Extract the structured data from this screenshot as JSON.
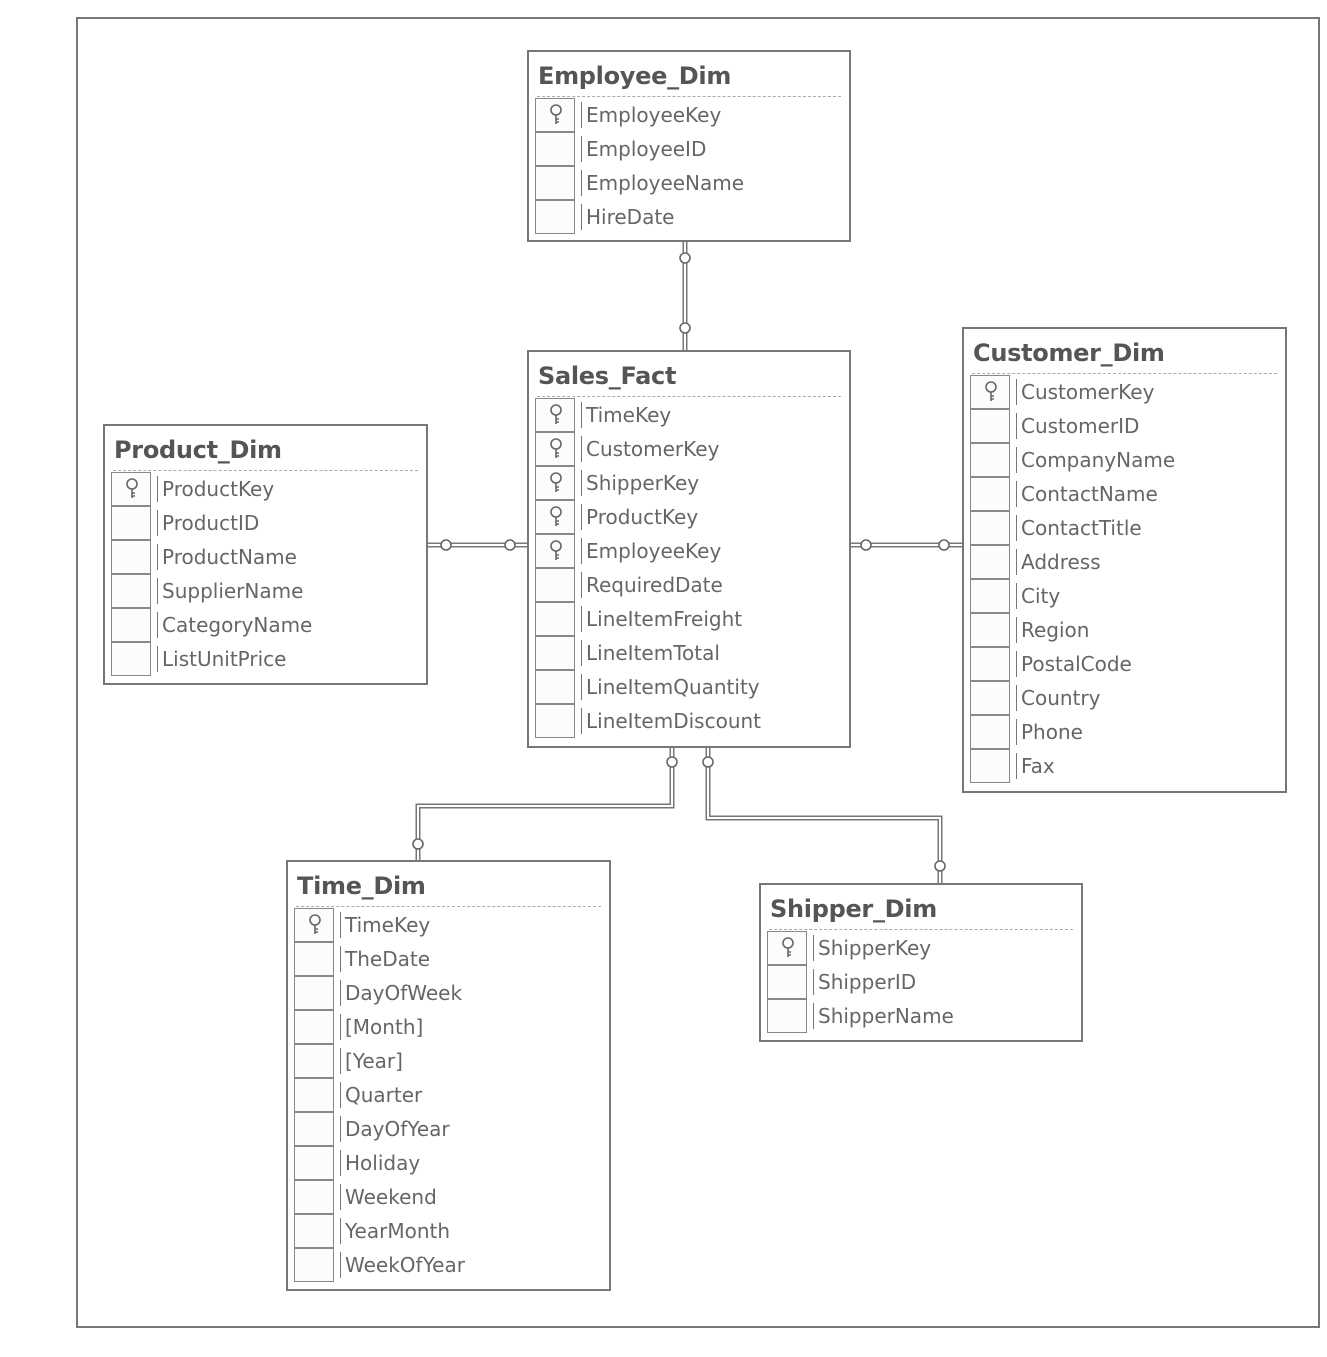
{
  "tables": [
    {
      "id": "employee",
      "name": "Employee_Dim",
      "fields": [
        {
          "name": "EmployeeKey",
          "key": true
        },
        {
          "name": "EmployeeID",
          "key": false
        },
        {
          "name": "EmployeeName",
          "key": false
        },
        {
          "name": "HireDate",
          "key": false
        }
      ]
    },
    {
      "id": "sales",
      "name": "Sales_Fact",
      "fields": [
        {
          "name": "TimeKey",
          "key": true
        },
        {
          "name": "CustomerKey",
          "key": true
        },
        {
          "name": "ShipperKey",
          "key": true
        },
        {
          "name": "ProductKey",
          "key": true
        },
        {
          "name": "EmployeeKey",
          "key": true
        },
        {
          "name": "RequiredDate",
          "key": false
        },
        {
          "name": "LineItemFreight",
          "key": false
        },
        {
          "name": "LineItemTotal",
          "key": false
        },
        {
          "name": "LineItemQuantity",
          "key": false
        },
        {
          "name": "LineItemDiscount",
          "key": false
        }
      ]
    },
    {
      "id": "product",
      "name": "Product_Dim",
      "fields": [
        {
          "name": "ProductKey",
          "key": true
        },
        {
          "name": "ProductID",
          "key": false
        },
        {
          "name": "ProductName",
          "key": false
        },
        {
          "name": "SupplierName",
          "key": false
        },
        {
          "name": "CategoryName",
          "key": false
        },
        {
          "name": "ListUnitPrice",
          "key": false
        }
      ]
    },
    {
      "id": "customer",
      "name": "Customer_Dim",
      "fields": [
        {
          "name": "CustomerKey",
          "key": true
        },
        {
          "name": "CustomerID",
          "key": false
        },
        {
          "name": "CompanyName",
          "key": false
        },
        {
          "name": "ContactName",
          "key": false
        },
        {
          "name": "ContactTitle",
          "key": false
        },
        {
          "name": "Address",
          "key": false
        },
        {
          "name": "City",
          "key": false
        },
        {
          "name": "Region",
          "key": false
        },
        {
          "name": "PostalCode",
          "key": false
        },
        {
          "name": "Country",
          "key": false
        },
        {
          "name": "Phone",
          "key": false
        },
        {
          "name": "Fax",
          "key": false
        }
      ]
    },
    {
      "id": "time",
      "name": "Time_Dim",
      "fields": [
        {
          "name": "TimeKey",
          "key": true
        },
        {
          "name": "TheDate",
          "key": false
        },
        {
          "name": "DayOfWeek",
          "key": false
        },
        {
          "name": "[Month]",
          "key": false
        },
        {
          "name": "[Year]",
          "key": false
        },
        {
          "name": "Quarter",
          "key": false
        },
        {
          "name": "DayOfYear",
          "key": false
        },
        {
          "name": "Holiday",
          "key": false
        },
        {
          "name": "Weekend",
          "key": false
        },
        {
          "name": "YearMonth",
          "key": false
        },
        {
          "name": "WeekOfYear",
          "key": false
        }
      ]
    },
    {
      "id": "shipper",
      "name": "Shipper_Dim",
      "fields": [
        {
          "name": "ShipperKey",
          "key": true
        },
        {
          "name": "ShipperID",
          "key": false
        },
        {
          "name": "ShipperName",
          "key": false
        }
      ]
    }
  ],
  "relationships": [
    {
      "from": "Sales_Fact",
      "to": "Employee_Dim",
      "key": "EmployeeKey"
    },
    {
      "from": "Sales_Fact",
      "to": "Product_Dim",
      "key": "ProductKey"
    },
    {
      "from": "Sales_Fact",
      "to": "Customer_Dim",
      "key": "CustomerKey"
    },
    {
      "from": "Sales_Fact",
      "to": "Time_Dim",
      "key": "TimeKey"
    },
    {
      "from": "Sales_Fact",
      "to": "Shipper_Dim",
      "key": "ShipperKey"
    }
  ],
  "icons": {
    "primary_key": "key-icon"
  }
}
